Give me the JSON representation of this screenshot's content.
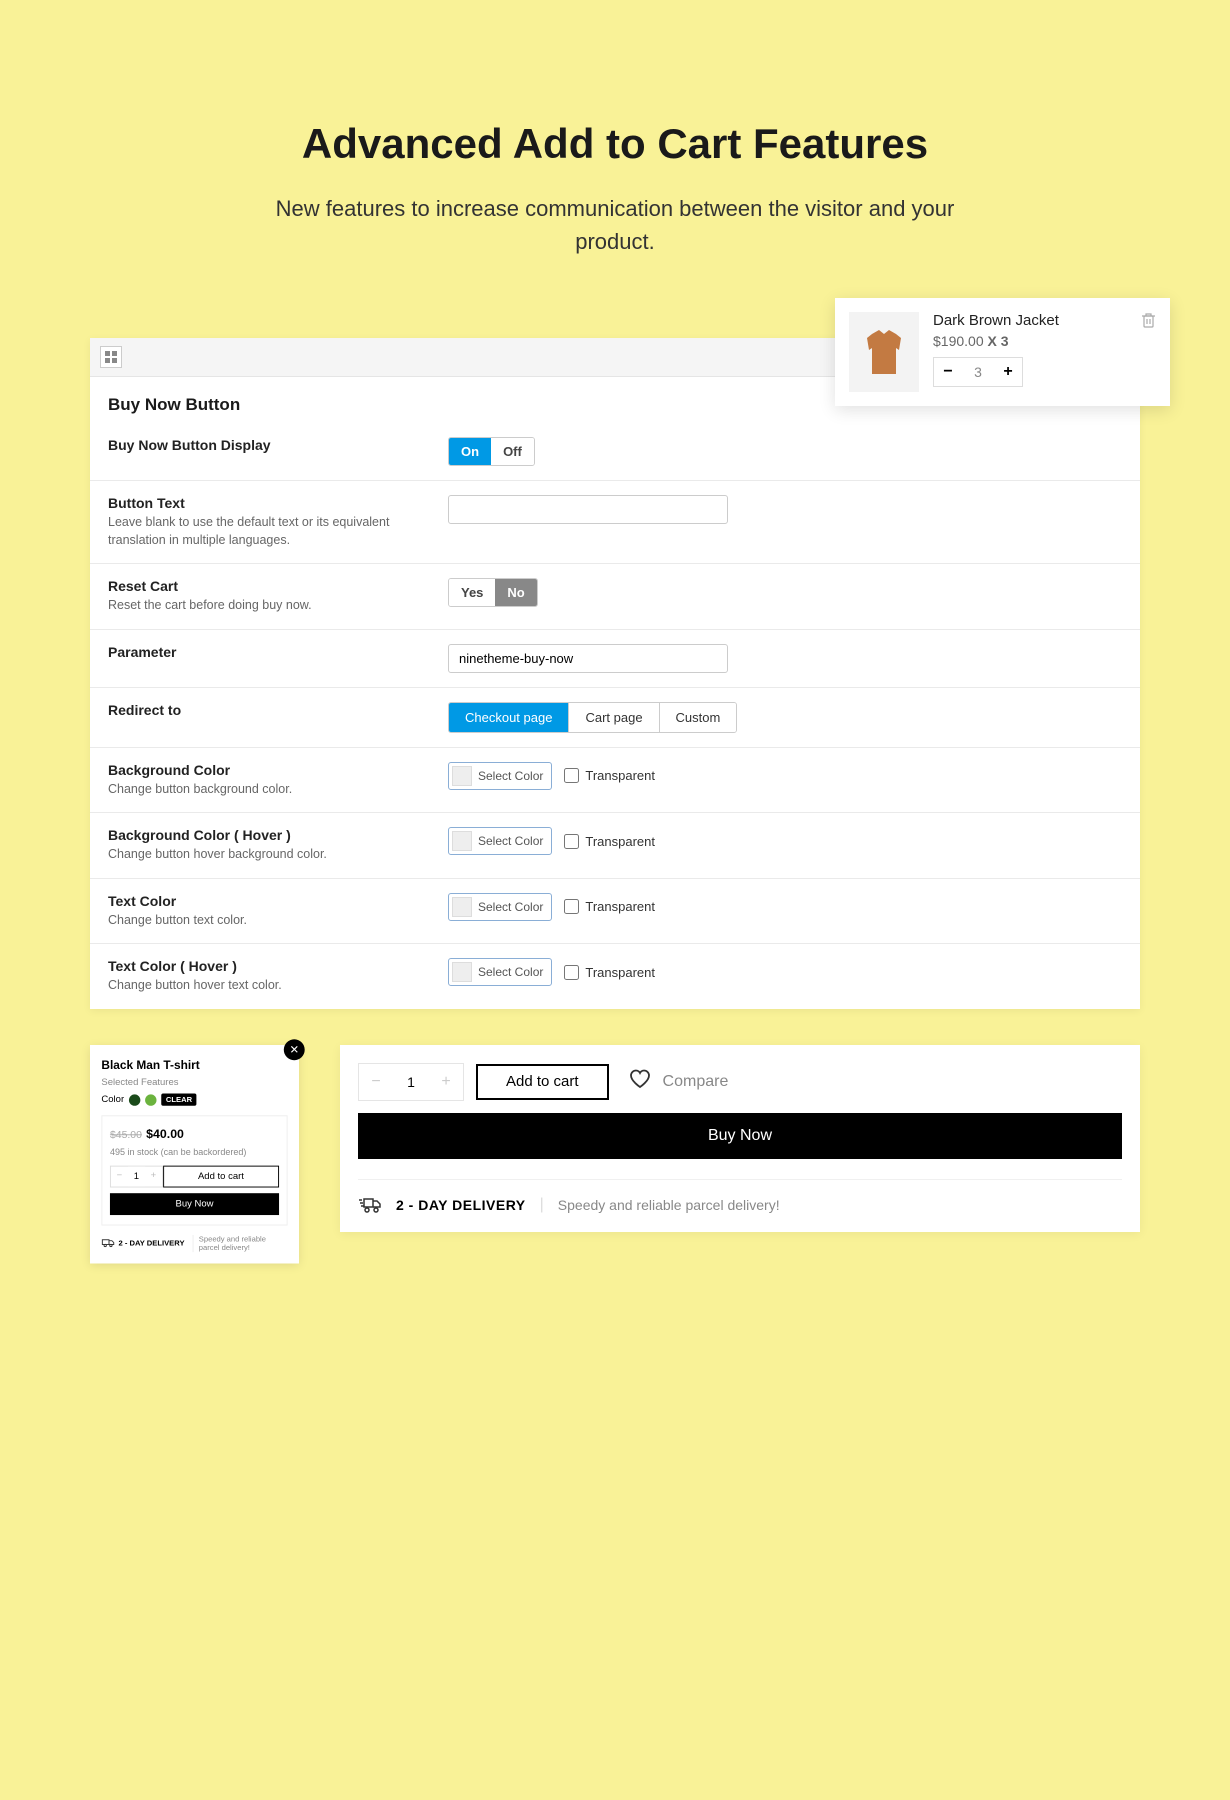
{
  "hero": {
    "title": "Advanced Add to Cart Features",
    "subtitle": "New features to increase communication between the visitor and your product."
  },
  "minicart": {
    "name": "Dark Brown Jacket",
    "price": "$190.00",
    "times": "X 3",
    "qty": "3"
  },
  "settings": {
    "section_title": "Buy Now Button",
    "display": {
      "label": "Buy Now Button Display",
      "on": "On",
      "off": "Off"
    },
    "button_text": {
      "label": "Button Text",
      "desc": "Leave blank to use the default text or its equivalent translation in multiple languages."
    },
    "reset_cart": {
      "label": "Reset Cart",
      "desc": "Reset the cart before doing buy now.",
      "yes": "Yes",
      "no": "No"
    },
    "parameter": {
      "label": "Parameter",
      "value": "ninetheme-buy-now"
    },
    "redirect": {
      "label": "Redirect to",
      "checkout": "Checkout page",
      "cart": "Cart page",
      "custom": "Custom"
    },
    "bg": {
      "label": "Background Color",
      "desc": "Change button background color."
    },
    "bg_hover": {
      "label": "Background Color ( Hover )",
      "desc": "Change button hover background color."
    },
    "text_color": {
      "label": "Text Color",
      "desc": "Change button text color."
    },
    "text_hover": {
      "label": "Text Color ( Hover )",
      "desc": "Change button hover text color."
    },
    "select_color": "Select Color",
    "transparent": "Transparent"
  },
  "quick": {
    "title": "Black Man T-shirt",
    "selected": "Selected Features",
    "color_label": "Color",
    "clear": "CLEAR",
    "price_old": "$45.00",
    "price_now": "$40.00",
    "stock": "495 in stock (can be backordered)",
    "qty": "1",
    "add": "Add to cart",
    "buy": "Buy Now",
    "delivery_title": "2 - DAY DELIVERY",
    "delivery_text": "Speedy and reliable parcel delivery!"
  },
  "wide": {
    "qty": "1",
    "add": "Add to cart",
    "compare": "Compare",
    "buy": "Buy Now",
    "delivery_title": "2 - DAY DELIVERY",
    "delivery_text": "Speedy and reliable parcel delivery!"
  }
}
